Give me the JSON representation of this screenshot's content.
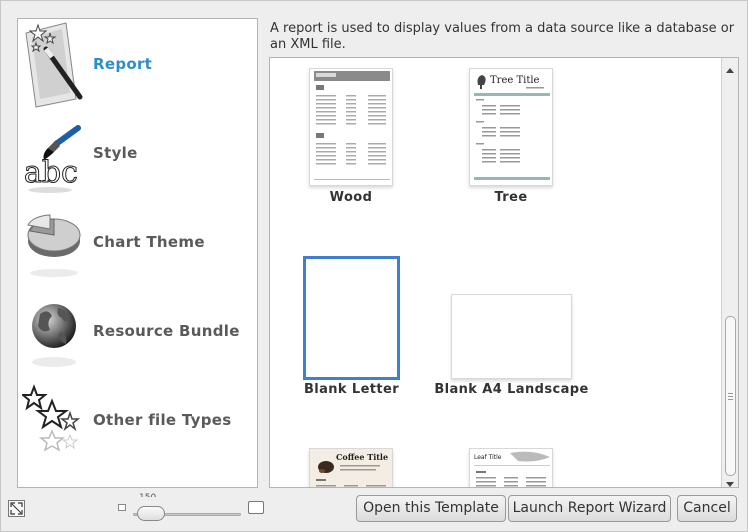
{
  "categories": [
    {
      "label": "Report",
      "icon": "magic-wand-icon",
      "active": true
    },
    {
      "label": "Style",
      "icon": "paintbrush-text-icon",
      "active": false
    },
    {
      "label": "Chart Theme",
      "icon": "pie-chart-icon",
      "active": false
    },
    {
      "label": "Resource Bundle",
      "icon": "globe-icon",
      "active": false
    },
    {
      "label": "Other file Types",
      "icon": "stars-icon",
      "active": false
    }
  ],
  "description": "A report is used to display values from a data source like a database or an XML file.",
  "templates": [
    {
      "label": "Wood",
      "selected": false
    },
    {
      "label": "Tree",
      "selected": false,
      "thumb_title": "Tree Title"
    },
    {
      "label": "Blank Letter",
      "selected": true
    },
    {
      "label": "Blank A4 Landscape",
      "selected": false
    },
    {
      "label": "",
      "thumb_title": "Coffee Title"
    },
    {
      "label": "",
      "thumb_title": "Leaf Title"
    }
  ],
  "footer": {
    "open_template": "Open this Template",
    "launch_wizard": "Launch Report Wizard",
    "cancel": "Cancel",
    "zoom_value": "150"
  },
  "colors": {
    "accent": "#2e8fc7",
    "selection": "#3f7fce"
  }
}
